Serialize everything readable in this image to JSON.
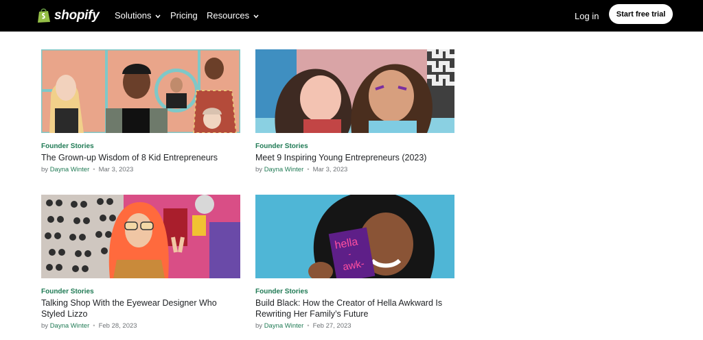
{
  "header": {
    "logo_text": "shopify",
    "nav": [
      {
        "label": "Solutions",
        "has_menu": true
      },
      {
        "label": "Pricing",
        "has_menu": false
      },
      {
        "label": "Resources",
        "has_menu": true
      }
    ],
    "login_label": "Log in",
    "cta_label": "Start free trial"
  },
  "articles": [
    {
      "category": "Founder Stories",
      "title": "The Grown-up Wisdom of 8 Kid Entrepreneurs",
      "by": "by",
      "author": "Dayna Winter",
      "date": "Mar 3, 2023"
    },
    {
      "category": "Founder Stories",
      "title": "Meet 9 Inspiring Young Entrepreneurs (2023)",
      "by": "by",
      "author": "Dayna Winter",
      "date": "Mar 3, 2023"
    },
    {
      "category": "Founder Stories",
      "title": "Talking Shop With the Eyewear Designer Who Styled Lizzo",
      "by": "by",
      "author": "Dayna Winter",
      "date": "Feb 28, 2023"
    },
    {
      "category": "Founder Stories",
      "title": "Build Black: How the Creator of Hella Awkward Is Rewriting Her Family’s Future",
      "by": "by",
      "author": "Dayna Winter",
      "date": "Feb 27, 2023",
      "image_text": [
        "hella",
        "-",
        "awk-"
      ]
    }
  ],
  "colors": {
    "accent_green": "#1f7a54",
    "header_bg": "#000000",
    "title_text": "#212326"
  }
}
